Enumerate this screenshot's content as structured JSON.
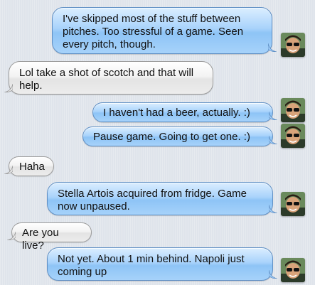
{
  "conversation": {
    "messages": [
      {
        "direction": "out",
        "text": "I've skipped most of the stuff between pitches.  Too stressful of a game.  Seen every pitch, though.",
        "avatar_icon": "user-avatar-icon"
      },
      {
        "direction": "in",
        "text": "Lol take a shot of scotch and that will help."
      },
      {
        "direction": "out",
        "text": "I haven't had a beer, actually.   :)",
        "avatar_icon": "user-avatar-icon"
      },
      {
        "direction": "out",
        "text": "Pause game.  Going to get one.  :)",
        "avatar_icon": "user-avatar-icon"
      },
      {
        "direction": "in",
        "text": "Haha"
      },
      {
        "direction": "out",
        "text": "Stella Artois acquired from fridge.  Game now unpaused.",
        "avatar_icon": "user-avatar-icon"
      },
      {
        "direction": "in",
        "text": "Are you live?"
      },
      {
        "direction": "out",
        "text": "Not yet.  About 1 min behind.  Napoli just coming up",
        "avatar_icon": "user-avatar-icon"
      }
    ]
  },
  "colors": {
    "background": "#dfe4eb",
    "outgoing_bubble": "#a9d3fb",
    "incoming_bubble": "#f3f3f3"
  }
}
